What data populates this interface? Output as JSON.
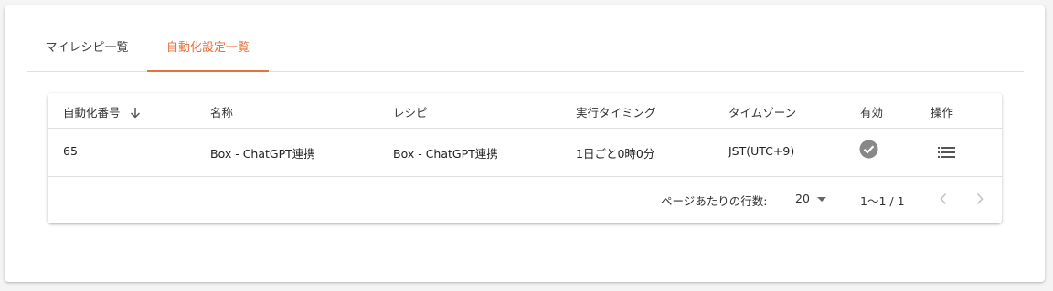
{
  "tabs": [
    {
      "label": "マイレシピ一覧"
    },
    {
      "label": "自動化設定一覧"
    }
  ],
  "table": {
    "headers": [
      "自動化番号",
      "名称",
      "レシピ",
      "実行タイミング",
      "タイムゾーン",
      "有効",
      "操作"
    ],
    "rows": [
      {
        "number": "65",
        "name": "Box - ChatGPT連携",
        "recipe": "Box - ChatGPT連携",
        "timing": "1日ごと0時0分",
        "timezone": "JST(UTC+9)",
        "enabled_icon": "check-circle-icon",
        "action_icon": "list-icon"
      }
    ]
  },
  "pagination": {
    "rows_per_page_label": "ページあたりの行数:",
    "rows_per_page": "20",
    "range": "1〜1 / 1"
  },
  "colors": {
    "accent": "#e8703a",
    "check": "#888888",
    "divider": "#e0e0e0"
  }
}
